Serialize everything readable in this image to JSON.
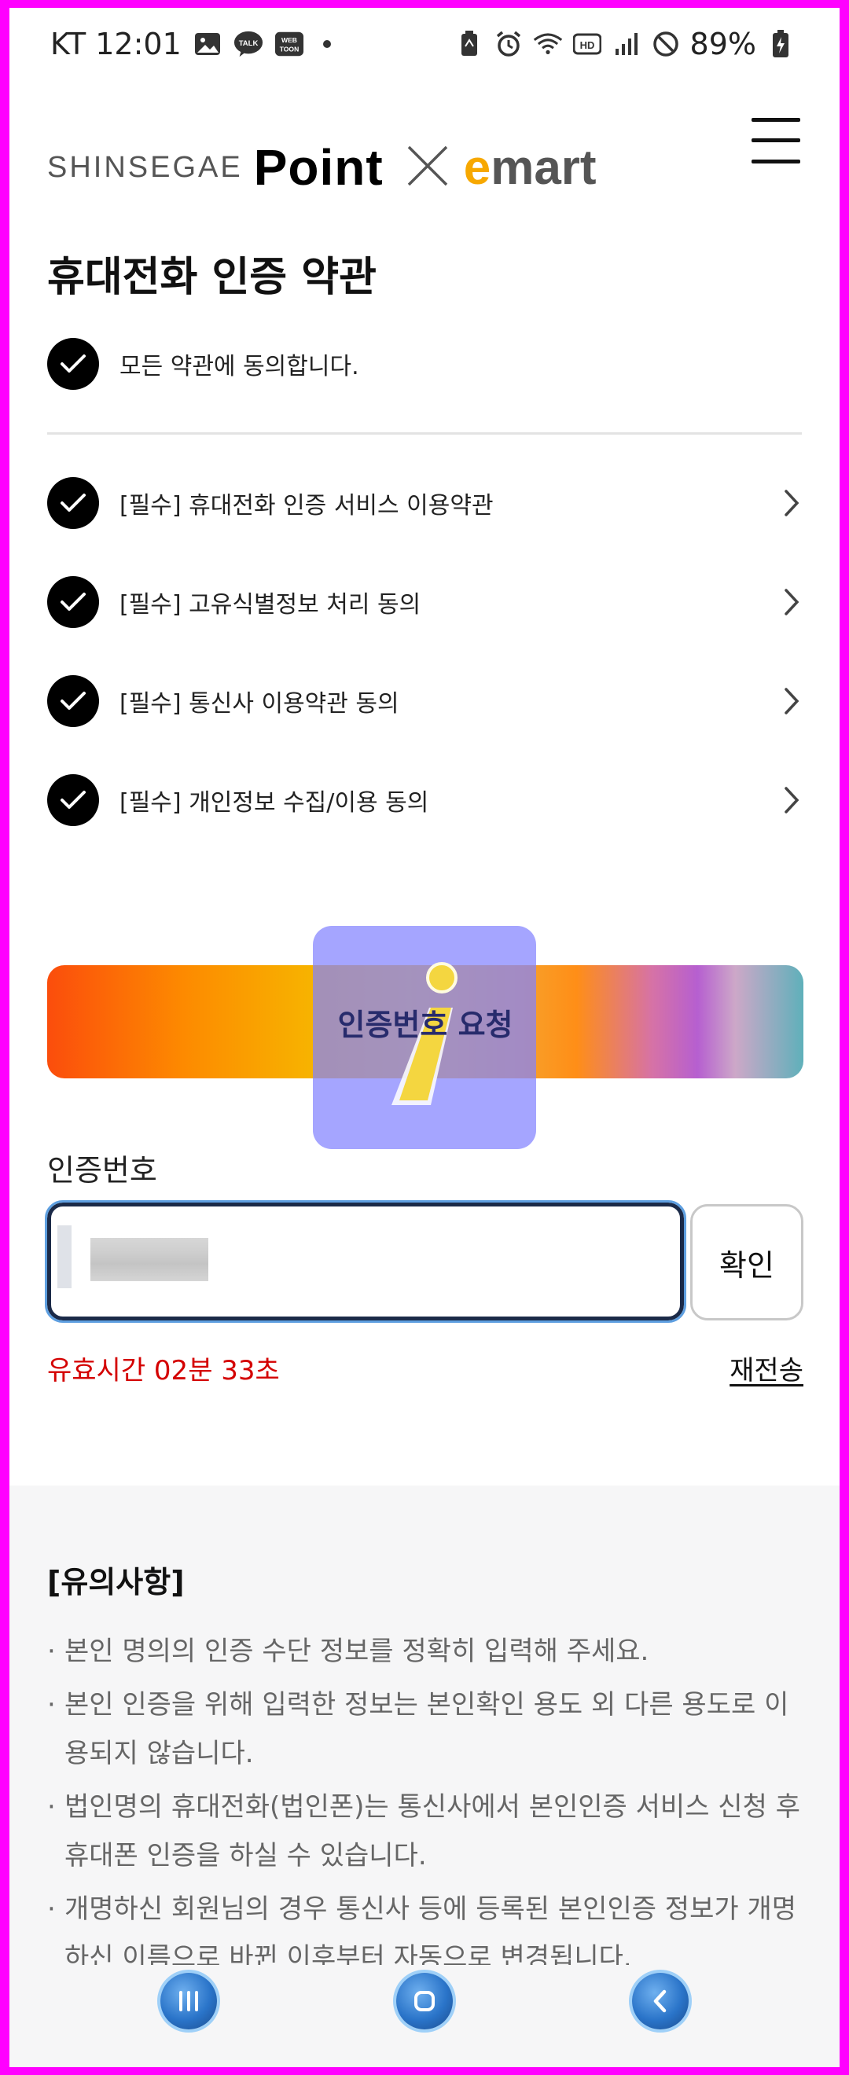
{
  "status_bar": {
    "carrier_time": "KT 12:01",
    "battery": "89%"
  },
  "header": {
    "brand_shinsegae": "SHINSEGAE",
    "brand_point": "Point",
    "brand_emart_e": "e",
    "brand_emart_rest": "mart"
  },
  "page": {
    "title": "휴대전화 인증 약관"
  },
  "agreements": {
    "all_label": "모든 약관에 동의합니다.",
    "items": [
      {
        "label": "[필수] 휴대전화 인증 서비스 이용약관"
      },
      {
        "label": "[필수] 고유식별정보 처리 동의"
      },
      {
        "label": "[필수] 통신사 이용약관 동의"
      },
      {
        "label": "[필수] 개인정보 수집/이용 동의"
      }
    ]
  },
  "verification": {
    "request_button": "인증번호 요청",
    "code_label": "인증번호",
    "confirm_button": "확인",
    "timer_text": "유효시간 02분 33초",
    "resend_link": "재전송"
  },
  "notice": {
    "title": "[유의사항]",
    "items": [
      "본인 명의의 인증 수단 정보를 정확히 입력해 주세요.",
      "본인 인증을 위해 입력한 정보는 본인확인 용도 외 다른 용도로 이용되지 않습니다.",
      "법인명의 휴대전화(법인폰)는 통신사에서 본인인증 서비스 신청 후 휴대폰 인증을 하실 수 있습니다.",
      "개명하신 회원님의 경우 통신사 등에 등록된 본인인증 정보가 개명하신 이름으로 바뀐 이후부터 자동으로 변경됩니다."
    ]
  },
  "colors": {
    "accent_red": "#d40000",
    "check_black": "#000000",
    "emart_yellow": "#f7a800",
    "overlay_blue": "#8282ff"
  }
}
